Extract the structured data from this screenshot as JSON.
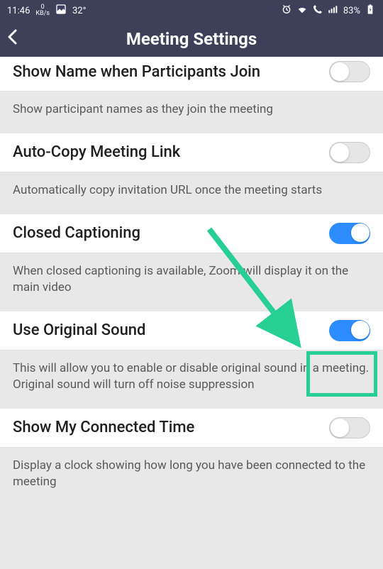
{
  "status_bar": {
    "time": "11:46",
    "speed_value": "0",
    "speed_unit": "KB/s",
    "temp": "32°",
    "battery": "83%"
  },
  "header": {
    "title": "Meeting Settings"
  },
  "settings": [
    {
      "title": "Show Name when Participants Join",
      "desc": "Show participant names as they join the meeting",
      "enabled": false
    },
    {
      "title": "Auto-Copy Meeting Link",
      "desc": "Automatically copy invitation URL once the meeting starts",
      "enabled": false
    },
    {
      "title": "Closed Captioning",
      "desc": "When closed captioning is available, Zoom will display it on the main video",
      "enabled": true
    },
    {
      "title": "Use Original Sound",
      "desc": "This will allow you to enable or disable original sound in a meeting. Original sound will turn off noise suppression",
      "enabled": true
    },
    {
      "title": "Show My Connected Time",
      "desc": "Display a clock showing how long you have been connected to the meeting",
      "enabled": false
    }
  ]
}
